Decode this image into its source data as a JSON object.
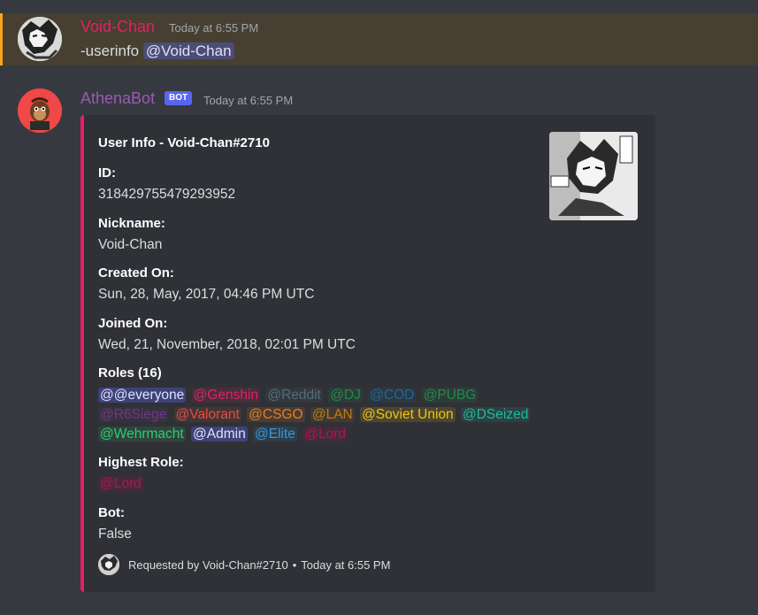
{
  "message1": {
    "username": "Void-Chan",
    "timestamp": "Today at 6:55 PM",
    "command": "-userinfo",
    "mention": "@Void-Chan"
  },
  "message2": {
    "username": "AthenaBot",
    "bot_tag": "BOT",
    "timestamp": "Today at 6:55 PM"
  },
  "embed": {
    "title": "User Info - Void-Chan#2710",
    "fields": [
      {
        "name": "ID:",
        "value": "318429755479293952"
      },
      {
        "name": "Nickname:",
        "value": "Void-Chan"
      },
      {
        "name": "Created On:",
        "value": "Sun, 28, May, 2017, 04:46 PM UTC"
      },
      {
        "name": "Joined On:",
        "value": "Wed, 21, November, 2018, 02:01 PM UTC"
      }
    ],
    "roles_label": "Roles (16)",
    "roles": [
      {
        "text": "@@everyone",
        "color": "#dee0fc",
        "bg": "rgba(88,101,242,0.35)"
      },
      {
        "text": "@Genshin",
        "color": "#e91e63",
        "bg": "rgba(233,30,99,0.12)"
      },
      {
        "text": "@Reddit",
        "color": "#546e7a",
        "bg": "rgba(84,110,122,0.12)"
      },
      {
        "text": "@DJ",
        "color": "#1f8b4c",
        "bg": "rgba(31,139,76,0.12)"
      },
      {
        "text": "@COD",
        "color": "#206694",
        "bg": "rgba(32,102,148,0.12)"
      },
      {
        "text": "@PUBG",
        "color": "#1f8b4c",
        "bg": "rgba(31,139,76,0.12)"
      },
      {
        "text": "@R6Siege",
        "color": "#71368a",
        "bg": "rgba(113,54,138,0.12)"
      },
      {
        "text": "@Valorant",
        "color": "#e74c3c",
        "bg": "rgba(231,76,60,0.12)"
      },
      {
        "text": "@CSGO",
        "color": "#e67e22",
        "bg": "rgba(230,126,34,0.15)"
      },
      {
        "text": "@LAN",
        "color": "#c27c0e",
        "bg": "rgba(194,124,14,0.12)"
      },
      {
        "text": "@Soviet Union",
        "color": "#f1c40f",
        "bg": "rgba(241,196,15,0.15)"
      },
      {
        "text": "@DSeized",
        "color": "#1abc9c",
        "bg": "rgba(26,188,156,0.12)"
      },
      {
        "text": "@Wehrmacht",
        "color": "#2ecc71",
        "bg": "rgba(46,204,113,0.12)"
      },
      {
        "text": "@Admin",
        "color": "#dee0fc",
        "bg": "rgba(88,101,242,0.35)"
      },
      {
        "text": "@Elite",
        "color": "#3498db",
        "bg": "rgba(52,152,219,0.12)"
      },
      {
        "text": "@Lord",
        "color": "#ad1457",
        "bg": "rgba(173,20,87,0.15)"
      }
    ],
    "highest_role_label": "Highest Role:",
    "highest_role": {
      "text": "@Lord",
      "color": "#ad1457",
      "bg": "rgba(173,20,87,0.15)"
    },
    "bot_label": "Bot:",
    "bot_value": "False",
    "footer_text": "Requested by Void-Chan#2710",
    "footer_time": "Today at 6:55 PM",
    "accent_color": "#e91e63"
  },
  "icons": [
    "user-avatar-icon",
    "bot-avatar-icon",
    "thumbnail-image",
    "footer-avatar-icon"
  ]
}
